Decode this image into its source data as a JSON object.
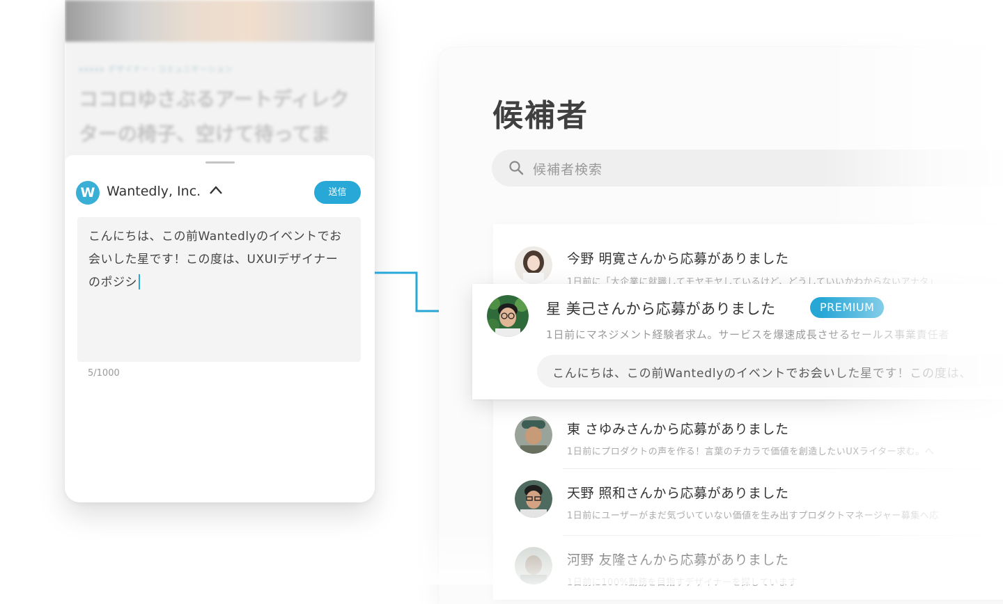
{
  "phone": {
    "background_tag": "xxxxx デザイナー・コミュニケーション",
    "background_headline": "ココロゆさぶるアートディレクターの椅子、空けて待ってます！",
    "company_name": "Wantedly, Inc.",
    "company_logo_letter": "W",
    "send_label": "送信",
    "message": "こんにちは、この前Wantedlyのイベントでお会いした星です！この度は、UXUIデザイナーのポジシ",
    "char_count": "5/1000"
  },
  "panel": {
    "title": "候補者",
    "search_placeholder": "候補者検索"
  },
  "highlight": {
    "name": "星 美己さんから応募がありました",
    "badge": "PREMIUM",
    "subtitle": "1日前にマネジメント経験者求ム。サービスを爆速成長させるセールス事業責任者",
    "message": "こんにちは、この前Wantedlyのイベントでお会いした星です！この度は、"
  },
  "candidates": [
    {
      "name": "今野 明寛さんから応募がありました",
      "subtitle": "1日前に「大企業に就職してモヤモヤしているけど、どうしていいかわからないアナタ」"
    },
    {
      "name": "東 さゆみさんから応募がありました",
      "subtitle": "1日前にプロダクトの声を作る！言葉のチカラで価値を創造したいUXライター求む。へ"
    },
    {
      "name": "天野 照和さんから応募がありました",
      "subtitle": "1日前にユーザーがまだ気づいていない価値を生み出すプロダクトマネージャー募集へ応"
    },
    {
      "name": "河野 友隆さんから応募がありました",
      "subtitle": "1日前に100%勤務を目指すデザイナーを探しています"
    }
  ],
  "colors": {
    "accent": "#28a8d6",
    "title_text": "#404040"
  }
}
